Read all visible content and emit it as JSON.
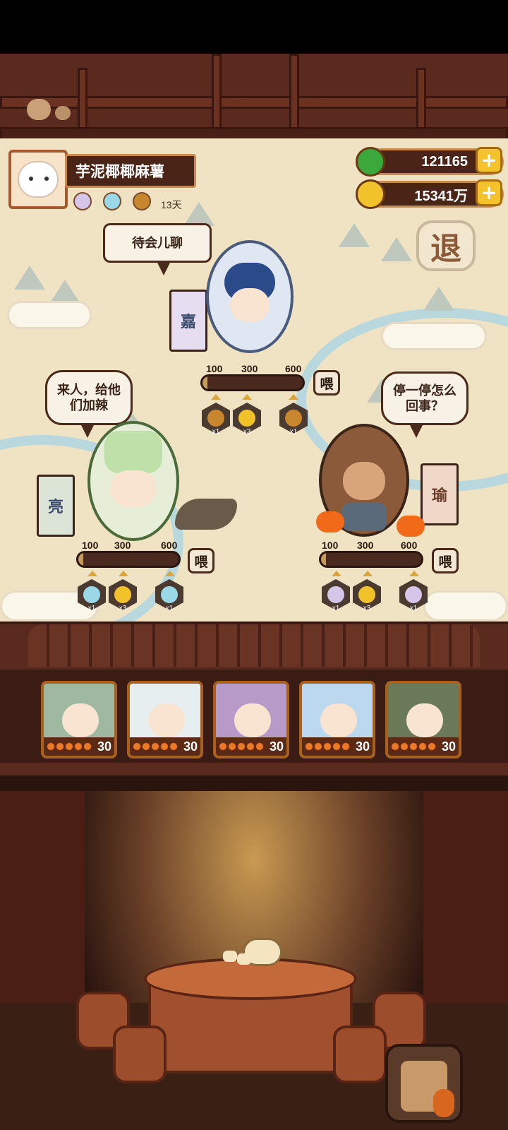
{
  "player": {
    "name": "芋泥椰椰麻薯",
    "days": "13天"
  },
  "resources": {
    "jade": "121165",
    "coins": "15341万"
  },
  "exit_label": "退",
  "guests": [
    {
      "id": "top",
      "speech": "待会儿聊",
      "banner": "嘉",
      "ticks": [
        "100",
        "300",
        "600"
      ],
      "progress": 0.05,
      "feed_label": "喂",
      "rewards": [
        {
          "icon": "key-icon",
          "count": "x1"
        },
        {
          "icon": "gold-item-icon",
          "count": "x3"
        },
        {
          "icon": "key-icon",
          "count": "x1"
        }
      ]
    },
    {
      "id": "left",
      "speech": "来人，给他们加辣",
      "banner": "亮",
      "ticks": [
        "100",
        "300",
        "600"
      ],
      "progress": 0.05,
      "feed_label": "喂",
      "rewards": [
        {
          "icon": "egg-icon",
          "count": "x1"
        },
        {
          "icon": "gold-item-icon",
          "count": "x3"
        },
        {
          "icon": "egg-icon",
          "count": "x1"
        }
      ]
    },
    {
      "id": "right",
      "speech": "停一停怎么回事？",
      "banner": "瑜",
      "ticks": [
        "100",
        "300",
        "600"
      ],
      "progress": 0.05,
      "feed_label": "喂",
      "rewards": [
        {
          "icon": "guest-token-icon",
          "count": "x1"
        },
        {
          "icon": "gold-item-icon",
          "count": "x3"
        },
        {
          "icon": "guest-token-icon",
          "count": "x1"
        }
      ]
    }
  ],
  "roster": [
    {
      "level": "30",
      "stars": 5,
      "color": "#9fb8a0"
    },
    {
      "level": "30",
      "stars": 5,
      "color": "#e6eef0"
    },
    {
      "level": "30",
      "stars": 5,
      "color": "#b89ac8"
    },
    {
      "level": "30",
      "stars": 5,
      "color": "#bcd8ee"
    },
    {
      "level": "30",
      "stars": 5,
      "color": "#6a7a58"
    }
  ],
  "colors": {
    "accent": "#f4c22a",
    "wood": "#5a2a1e",
    "parchment": "#efe3c4"
  }
}
